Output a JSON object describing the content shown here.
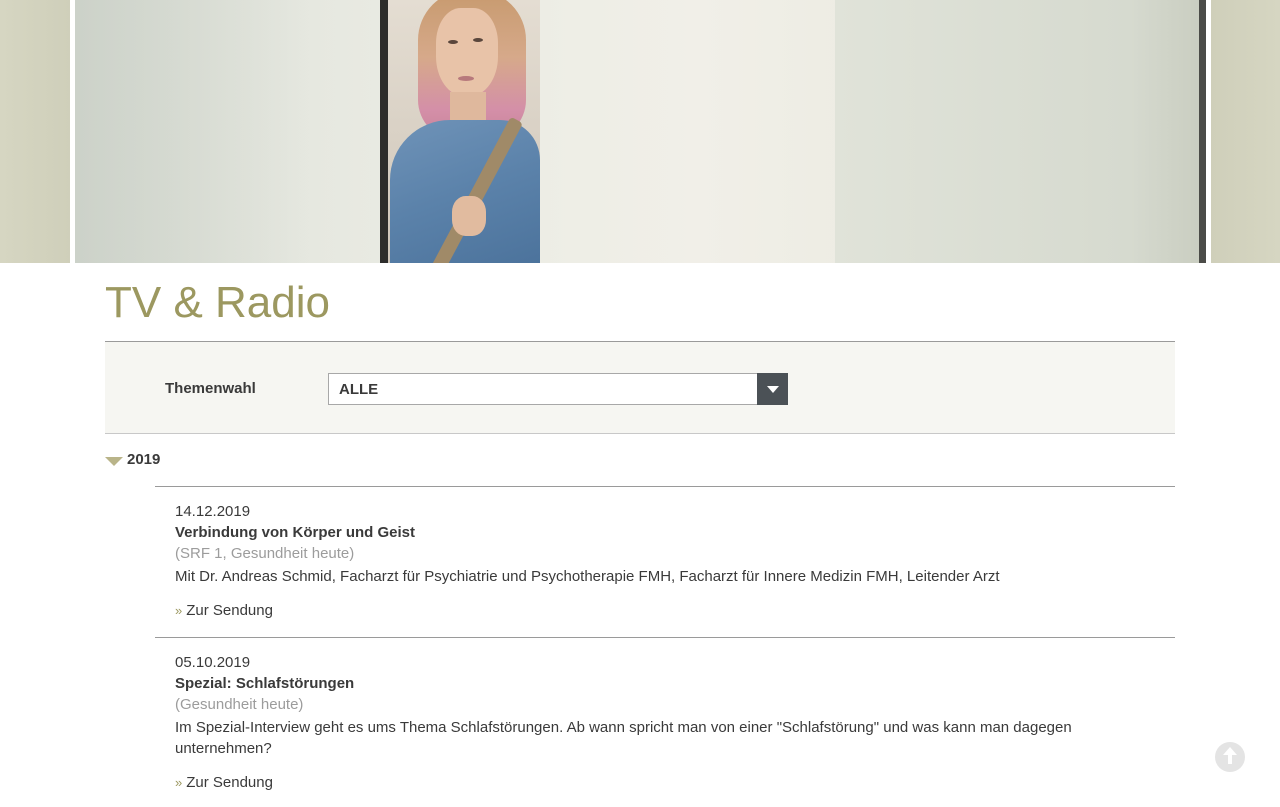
{
  "page": {
    "title": "TV & Radio"
  },
  "filter": {
    "label": "Themenwahl",
    "selected": "ALLE"
  },
  "years": [
    {
      "label": "2019",
      "expanded": true
    }
  ],
  "entries": [
    {
      "date": "14.12.2019",
      "title": "Verbindung von Körper und Geist",
      "source": "(SRF 1, Gesundheit heute)",
      "description": "Mit Dr. Andreas Schmid, Facharzt für Psychiatrie und Psychotherapie FMH, Facharzt für Innere Medizin FMH, Leitender Arzt",
      "link_label": "Zur Sendung"
    },
    {
      "date": "05.10.2019",
      "title": "Spezial: Schlafstörungen",
      "source": "(Gesundheit heute)",
      "description": "Im Spezial-Interview geht es ums Thema Schlafstörungen. Ab wann spricht man von einer \"Schlafstörung\" und was kann man dagegen unternehmen?",
      "link_label": "Zur Sendung"
    }
  ],
  "icons": {
    "collapse_toggle": "triangle-down-icon",
    "select_arrow": "chevron-down-icon",
    "link_marker": "double-chevron-right-icon",
    "scroll_top": "arrow-up-icon"
  },
  "colors": {
    "title": "#9c9860",
    "accent": "#b9b489",
    "filter_bg": "#f6f6f2",
    "select_button": "#4b5156",
    "muted_text": "#9c9c9c"
  }
}
